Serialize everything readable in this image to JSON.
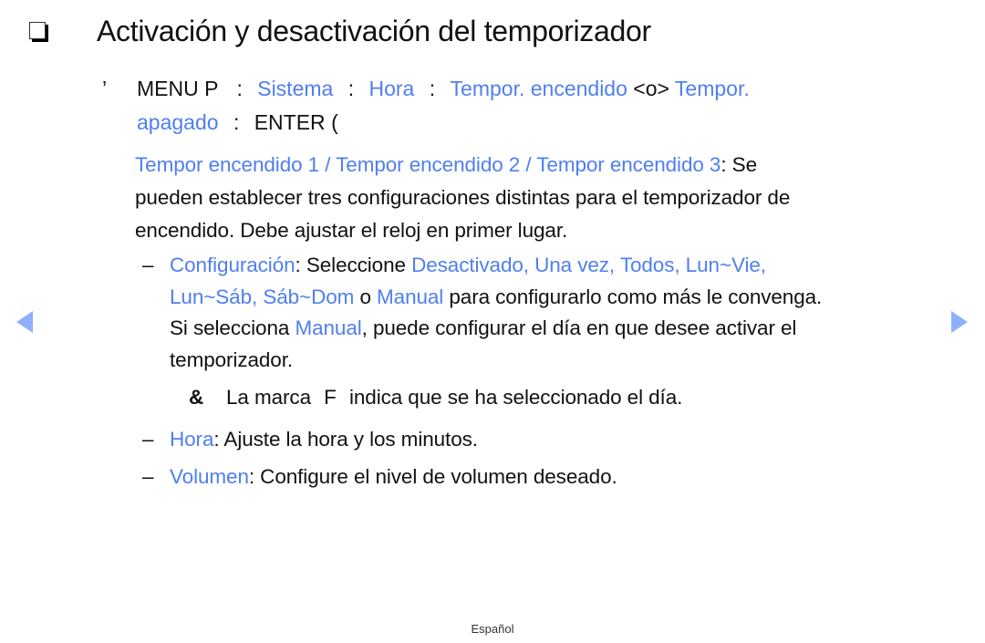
{
  "title": "Activación y desactivación del temporizador",
  "title_icon": "checkbox-icon",
  "menu_path": {
    "bullet": "’",
    "menu": "MENU",
    "menu_suffix": "P",
    "sep": ":",
    "sistema": "Sistema",
    "hora": "Hora",
    "tempor_encendido": "Tempor. encendido",
    "or": "<o>",
    "tempor": "Tempor.",
    "apagado": "apagado",
    "enter": "ENTER",
    "enter_suffix": "("
  },
  "intro": {
    "highlight": "Tempor encendido 1 / Tempor encendido 2 / Tempor encendido 3",
    "line1_rest": ": Se",
    "line2": "pueden establecer tres configuraciones distintas para el temporizador de",
    "line3": "encendido. Debe ajustar el reloj en primer lugar."
  },
  "items": {
    "dash": "–",
    "config": {
      "label": "Configuración",
      "t1": ": Seleccione ",
      "opts1": "Desactivado, Una vez, Todos, Lun~Vie,",
      "opts2": "Lun~Sáb, Sáb~Dom",
      "t2": " o ",
      "manual": "Manual",
      "t3": " para configurarlo como más le convenga.",
      "t4": "Si selecciona ",
      "manual2": "Manual",
      "t5": ", puede configurar el día en que desee activar el",
      "t6": "temporizador."
    },
    "note": {
      "icon": "&",
      "text_a": "La marca",
      "mark": "F",
      "text_b": "indica que se ha seleccionado el día."
    },
    "hora": {
      "label": "Hora",
      "text": ": Ajuste la hora y los minutos."
    },
    "volumen": {
      "label": "Volumen",
      "text": ": Configure el nivel de volumen deseado."
    }
  },
  "nav": {
    "prev": "previous-page",
    "next": "next-page"
  },
  "footer": "Español"
}
